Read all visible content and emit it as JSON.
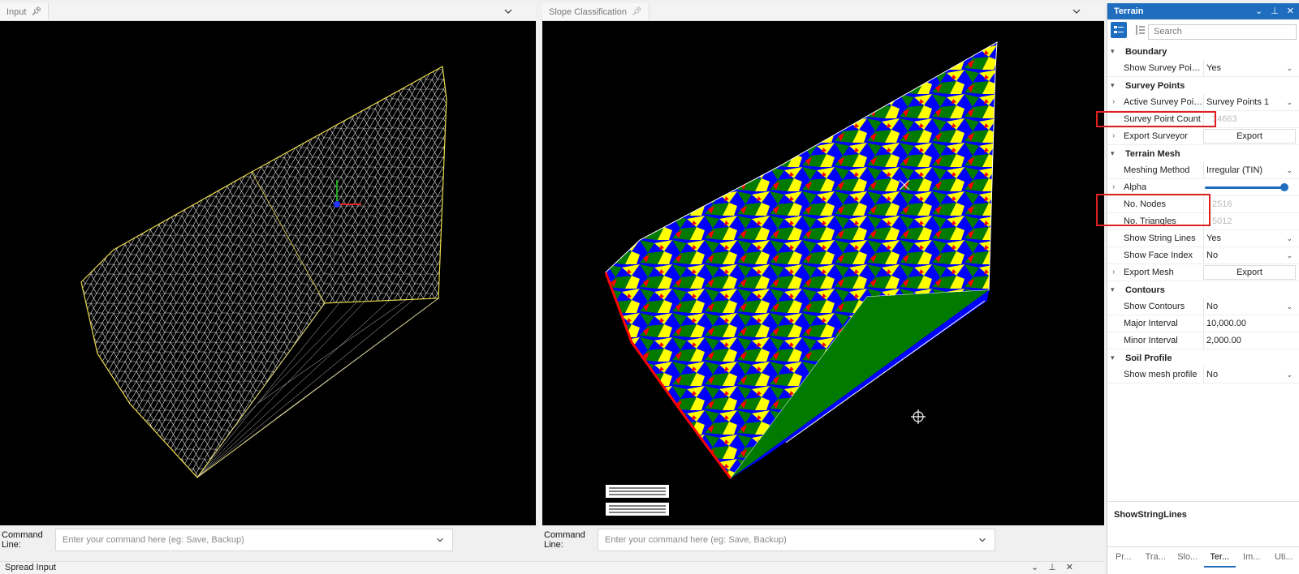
{
  "left_pane": {
    "tab_label": "Input",
    "cmd_label": "Command Line:",
    "cmd_placeholder": "Enter your command here (eg: Save, Backup)"
  },
  "right_pane": {
    "tab_label": "Slope Classification",
    "cmd_label": "Command Line:",
    "cmd_placeholder": "Enter your command here (eg: Save, Backup)"
  },
  "spread": {
    "label": "Spread Input"
  },
  "panel": {
    "title": "Terrain",
    "search_placeholder": "Search",
    "sections": {
      "boundary": "Boundary",
      "survey_points": "Survey Points",
      "terrain_mesh": "Terrain Mesh",
      "contours": "Contours",
      "soil_profile": "Soil Profile"
    },
    "props": {
      "show_survey_points": {
        "name": "Show Survey Point...",
        "value": "Yes"
      },
      "active_survey_points": {
        "name": "Active Survey Point...",
        "value": "Survey Points 1"
      },
      "survey_point_count": {
        "name": "Survey Point Count",
        "value": "14663"
      },
      "export_surveyor": {
        "name": "Export Surveyor",
        "value": "Export"
      },
      "meshing_method": {
        "name": "Meshing Method",
        "value": "Irregular (TIN)"
      },
      "alpha": {
        "name": "Alpha",
        "value": 1.0
      },
      "no_nodes": {
        "name": "No. Nodes",
        "value": "2516"
      },
      "no_triangles": {
        "name": "No. Triangles",
        "value": "5012"
      },
      "show_string_lines": {
        "name": "Show String Lines",
        "value": "Yes"
      },
      "show_face_index": {
        "name": "Show Face Index",
        "value": "No"
      },
      "export_mesh": {
        "name": "Export Mesh",
        "value": "Export"
      },
      "show_contours": {
        "name": "Show Contours",
        "value": "No"
      },
      "major_interval": {
        "name": "Major Interval",
        "value": "10,000.00"
      },
      "minor_interval": {
        "name": "Minor Interval",
        "value": "2,000.00"
      },
      "show_mesh_profile": {
        "name": "Show mesh profile",
        "value": "No"
      }
    },
    "description": "ShowStringLines",
    "bottom_tabs": [
      "Pr...",
      "Tra...",
      "Slo...",
      "Ter...",
      "Im...",
      "Uti..."
    ],
    "active_tab": "Ter..."
  },
  "colors": {
    "accent": "#1e6dbf",
    "highlight": "#e02020",
    "slope_blue": "#0000ff",
    "slope_green": "#007a00",
    "slope_yellow": "#ffff00",
    "slope_red": "#ff0000",
    "mesh_outline": "#e8d94a"
  }
}
